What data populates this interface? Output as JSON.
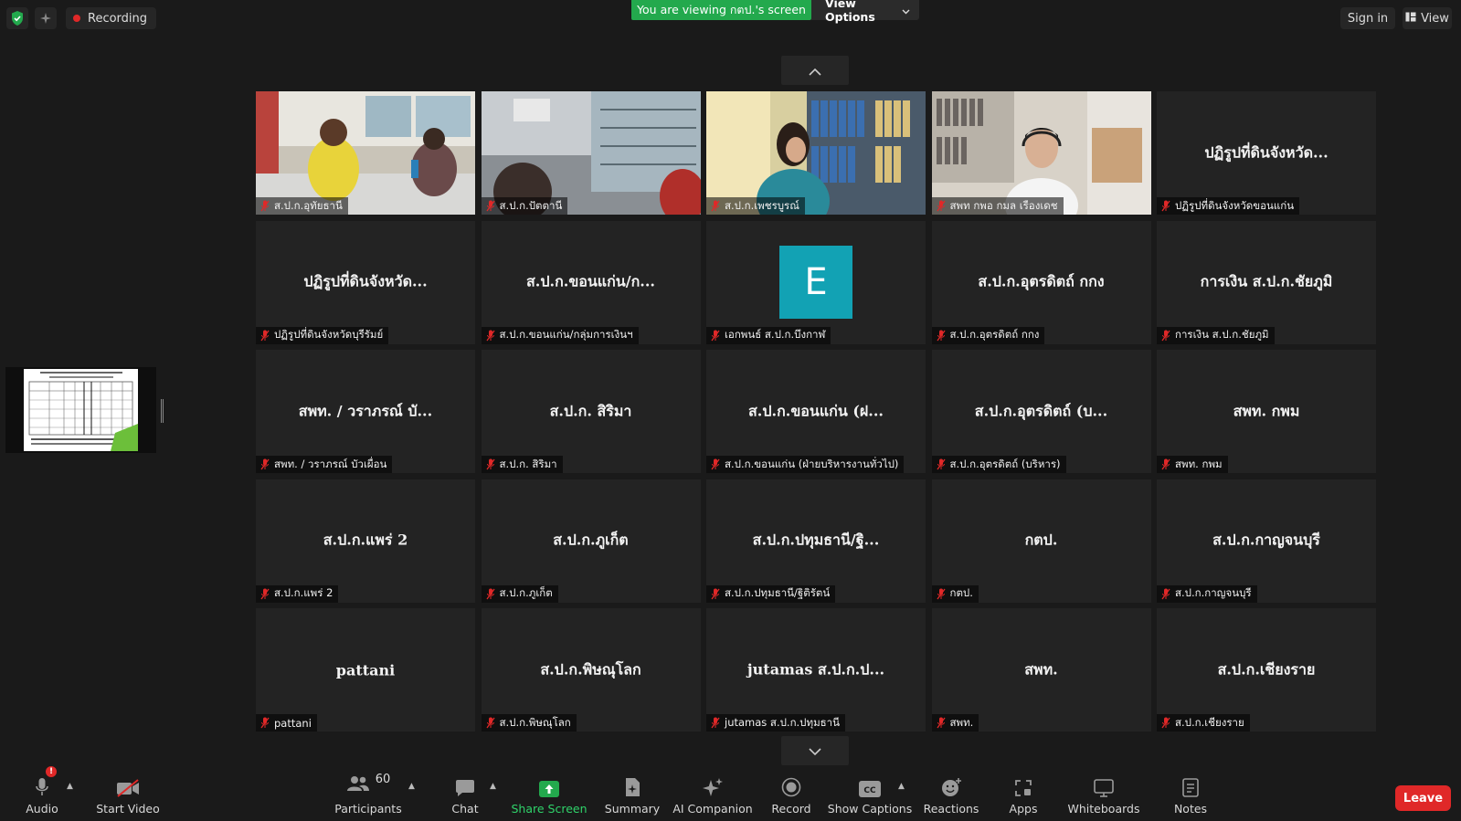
{
  "top_bar": {
    "recording_label": "Recording",
    "viewing_banner": "You are viewing กตป.'s screen",
    "view_options_label": "View Options",
    "sign_in_label": "Sign in",
    "view_label": "View"
  },
  "tiles": [
    {
      "display": "",
      "label": "ส.ป.ก.อุทัยธานี",
      "kind": "video",
      "video": "video-1"
    },
    {
      "display": "",
      "label": "ส.ป.ก.ปัตตานี",
      "kind": "video",
      "video": "video-2"
    },
    {
      "display": "",
      "label": "ส.ป.ก.เพชรบูรณ์",
      "kind": "video",
      "video": "video-3"
    },
    {
      "display": "",
      "label": "สพท กพอ กมล เรืองเดช",
      "kind": "video",
      "video": "video-4"
    },
    {
      "display": "ปฏิรูปที่ดินจังหวัด...",
      "label": "ปฏิรูปที่ดินจังหวัดขอนแก่น",
      "kind": "name"
    },
    {
      "display": "ปฏิรูปที่ดินจังหวัด...",
      "label": "ปฏิรูปที่ดินจังหวัดบุรีรัมย์",
      "kind": "name"
    },
    {
      "display": "ส.ป.ก.ขอนแก่น/ก...",
      "label": "ส.ป.ก.ขอนแก่น/กลุ่มการเงินฯ",
      "kind": "name"
    },
    {
      "display": "E",
      "label": "เอกพนธ์ ส.ป.ก.บึงกาฬ",
      "kind": "avatar"
    },
    {
      "display": "ส.ป.ก.อุตรดิตถ์ กกง",
      "label": "ส.ป.ก.อุตรดิตถ์ กกง",
      "kind": "name"
    },
    {
      "display": "การเงิน ส.ป.ก.ชัยภูมิ",
      "label": "การเงิน ส.ป.ก.ชัยภูมิ",
      "kind": "name"
    },
    {
      "display": "สพท. / วราภรณ์ บั...",
      "label": "สพท. / วราภรณ์ บัวเผื่อน",
      "kind": "name"
    },
    {
      "display": "ส.ป.ก. สิริมา",
      "label": "ส.ป.ก. สิริมา",
      "kind": "name"
    },
    {
      "display": "ส.ป.ก.ขอนแก่น (ฝ...",
      "label": "ส.ป.ก.ขอนแก่น (ฝ่ายบริหารงานทั่วไป)",
      "kind": "name"
    },
    {
      "display": "ส.ป.ก.อุตรดิตถ์ (บ...",
      "label": "ส.ป.ก.อุตรดิตถ์ (บริหาร)",
      "kind": "name"
    },
    {
      "display": "สพท. กพม",
      "label": "สพท. กพม",
      "kind": "name"
    },
    {
      "display": "ส.ป.ก.แพร่ 2",
      "label": "ส.ป.ก.แพร่ 2",
      "kind": "name"
    },
    {
      "display": "ส.ป.ก.ภูเก็ต",
      "label": "ส.ป.ก.ภูเก็ต",
      "kind": "name"
    },
    {
      "display": "ส.ป.ก.ปทุมธานี/ฐิ...",
      "label": "ส.ป.ก.ปทุมธานี/ฐิติรัตน์",
      "kind": "name"
    },
    {
      "display": "กตป.",
      "label": "กตป.",
      "kind": "name"
    },
    {
      "display": "ส.ป.ก.กาญจนบุรี",
      "label": "ส.ป.ก.กาญจนบุรี",
      "kind": "name"
    },
    {
      "display": "pattani",
      "label": "pattani",
      "kind": "name"
    },
    {
      "display": "ส.ป.ก.พิษณุโลก",
      "label": "ส.ป.ก.พิษณุโลก",
      "kind": "name"
    },
    {
      "display": "jutamas ส.ป.ก.ป...",
      "label": "jutamas ส.ป.ก.ปทุมธานี",
      "kind": "name"
    },
    {
      "display": "สพท.",
      "label": "สพท.",
      "kind": "name"
    },
    {
      "display": "ส.ป.ก.เชียงราย",
      "label": "ส.ป.ก.เชียงราย",
      "kind": "name"
    }
  ],
  "toolbar": {
    "audio_label": "Audio",
    "start_video_label": "Start Video",
    "participants_label": "Participants",
    "participants_count": "60",
    "chat_label": "Chat",
    "share_screen_label": "Share Screen",
    "summary_label": "Summary",
    "ai_companion_label": "AI Companion",
    "record_label": "Record",
    "show_captions_label": "Show Captions",
    "reactions_label": "Reactions",
    "apps_label": "Apps",
    "whiteboards_label": "Whiteboards",
    "notes_label": "Notes",
    "leave_label": "Leave",
    "audio_badge": "!"
  },
  "colors": {
    "background": "#1a1a1a",
    "tile": "#232323",
    "share_green": "#23a94d",
    "leave_red": "#e02828",
    "muted_red": "#e02828",
    "avatar_teal": "#12a2b4"
  }
}
